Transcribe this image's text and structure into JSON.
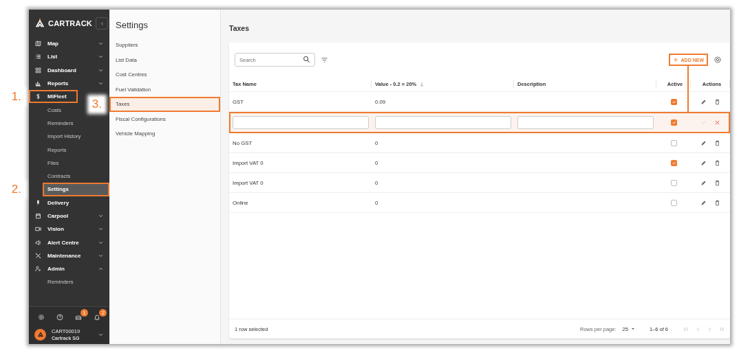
{
  "sidebar": {
    "logo": "CARTRACK",
    "items": [
      {
        "label": "Map",
        "expanded": false
      },
      {
        "label": "List",
        "expanded": false
      },
      {
        "label": "Dashboard",
        "expanded": false
      },
      {
        "label": "Reports",
        "expanded": false
      },
      {
        "label": "MiFleet",
        "expanded": true,
        "highlighted": true,
        "callout": "1.",
        "children": [
          {
            "label": "Costs",
            "selected": false,
            "highlighted": false
          },
          {
            "label": "Reminders",
            "selected": false,
            "highlighted": false
          },
          {
            "label": "Import History",
            "selected": false,
            "highlighted": false
          },
          {
            "label": "Reports",
            "selected": false,
            "highlighted": false
          },
          {
            "label": "Files",
            "selected": false,
            "highlighted": false
          },
          {
            "label": "Contracts",
            "selected": false,
            "highlighted": false
          },
          {
            "label": "Settings",
            "selected": true,
            "highlighted": true,
            "callout": "2."
          }
        ]
      },
      {
        "label": "Delivery"
      },
      {
        "label": "Carpool",
        "expanded": false
      },
      {
        "label": "Vision",
        "expanded": false
      },
      {
        "label": "Alert Centre",
        "expanded": false
      },
      {
        "label": "Maintenance",
        "expanded": false
      },
      {
        "label": "Admin",
        "expanded": true,
        "highlighted": false,
        "children": [
          {
            "label": "Reminders",
            "selected": false,
            "highlighted": false
          }
        ]
      }
    ],
    "footer": {
      "vehicle_badge": "1",
      "alerts_badge": "2",
      "account": "CART00019",
      "company": "Cartrack SG"
    }
  },
  "settings_panel": {
    "title": "Settings",
    "items": [
      {
        "label": "Suppliers",
        "selected": false,
        "highlighted": false
      },
      {
        "label": "List Data",
        "selected": false,
        "highlighted": false
      },
      {
        "label": "Cost Centres",
        "selected": false,
        "highlighted": false
      },
      {
        "label": "Fuel Validation",
        "selected": false,
        "highlighted": false
      },
      {
        "label": "Taxes",
        "selected": true,
        "highlighted": true,
        "callout": "3."
      },
      {
        "label": "Fiscal Configurations",
        "selected": false,
        "highlighted": false
      },
      {
        "label": "Vehicle Mapping",
        "selected": false,
        "highlighted": false
      }
    ]
  },
  "main": {
    "title": "Taxes",
    "toolbar": {
      "search": {
        "placeholder": "Search"
      },
      "add_button": {
        "label": "ADD NEW",
        "highlighted": true
      }
    },
    "table": {
      "columns": [
        {
          "label": "Tax Name",
          "sorted_descending": false
        },
        {
          "label": "Value - 0.2 = 20%",
          "sorted_descending": true
        },
        {
          "label": "Description",
          "sorted_descending": false
        },
        {
          "label": "Active",
          "sorted_descending": false
        },
        {
          "label": "Actions",
          "sorted_descending": false
        }
      ],
      "rows": [
        {
          "kind": "data",
          "tax_name": "GST",
          "value": "0.09",
          "active": true,
          "highlighted": false
        },
        {
          "kind": "editing",
          "active": true,
          "highlighted": true
        },
        {
          "kind": "data",
          "tax_name": "No GST",
          "value": "0",
          "active": false,
          "highlighted": false
        },
        {
          "kind": "data",
          "tax_name": "Import VAT 0",
          "value": "0",
          "active": true,
          "highlighted": false
        },
        {
          "kind": "data",
          "tax_name": "Import VAT 0",
          "value": "0",
          "active": false,
          "highlighted": false
        },
        {
          "kind": "data",
          "tax_name": "Online",
          "value": "0",
          "active": false,
          "highlighted": false
        }
      ]
    },
    "footer": {
      "selection": "1 row selected",
      "rows_per_page_label": "Rows per page:",
      "rows_per_page": "25",
      "range": "1–6 of 6"
    }
  }
}
